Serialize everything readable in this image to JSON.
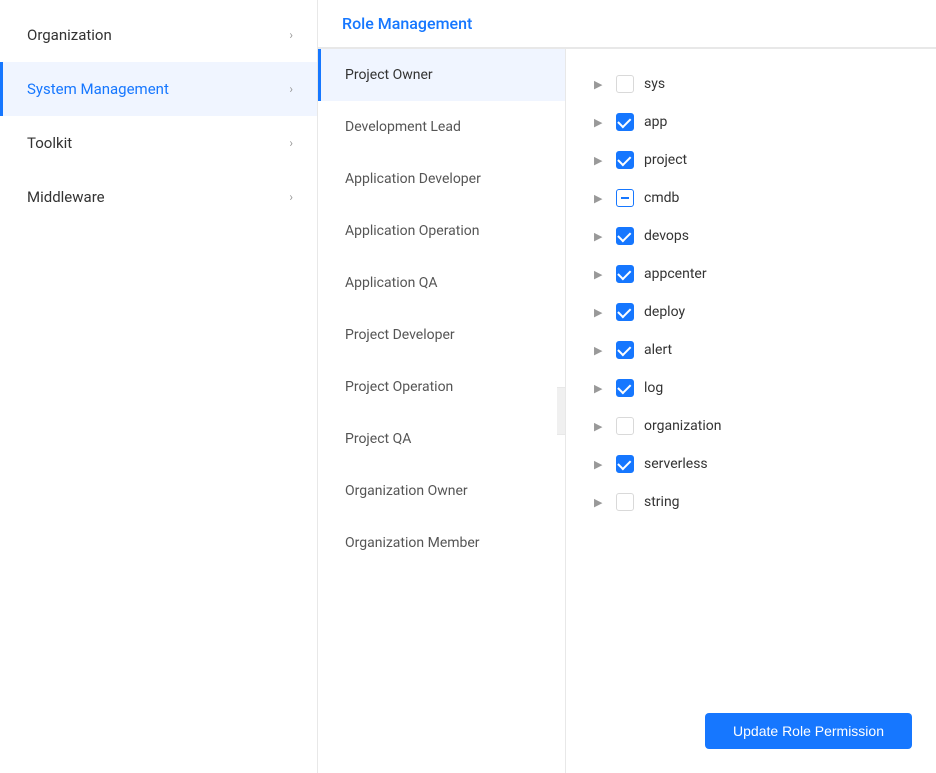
{
  "sidebar": {
    "items": [
      {
        "id": "organization",
        "label": "Organization",
        "hasArrow": true,
        "active": false
      },
      {
        "id": "system-management",
        "label": "System Management",
        "hasArrow": true,
        "active": true
      },
      {
        "id": "toolkit",
        "label": "Toolkit",
        "hasArrow": true,
        "active": false
      },
      {
        "id": "middleware",
        "label": "Middleware",
        "hasArrow": true,
        "active": false
      }
    ]
  },
  "page": {
    "title": "Role Management"
  },
  "roles": [
    {
      "id": "project-owner",
      "label": "Project Owner",
      "active": true
    },
    {
      "id": "development-lead",
      "label": "Development Lead",
      "active": false
    },
    {
      "id": "application-developer",
      "label": "Application Developer",
      "active": false
    },
    {
      "id": "application-operation",
      "label": "Application Operation",
      "active": false
    },
    {
      "id": "application-qa",
      "label": "Application QA",
      "active": false
    },
    {
      "id": "project-developer",
      "label": "Project Developer",
      "active": false
    },
    {
      "id": "project-operation",
      "label": "Project Operation",
      "active": false
    },
    {
      "id": "project-qa",
      "label": "Project QA",
      "active": false
    },
    {
      "id": "organization-owner",
      "label": "Organization Owner",
      "active": false
    },
    {
      "id": "organization-member",
      "label": "Organization Member",
      "active": false
    }
  ],
  "permissions": [
    {
      "id": "sys",
      "label": "sys",
      "state": "unchecked"
    },
    {
      "id": "app",
      "label": "app",
      "state": "checked"
    },
    {
      "id": "project",
      "label": "project",
      "state": "checked"
    },
    {
      "id": "cmdb",
      "label": "cmdb",
      "state": "indeterminate"
    },
    {
      "id": "devops",
      "label": "devops",
      "state": "checked"
    },
    {
      "id": "appcenter",
      "label": "appcenter",
      "state": "checked"
    },
    {
      "id": "deploy",
      "label": "deploy",
      "state": "checked"
    },
    {
      "id": "alert",
      "label": "alert",
      "state": "checked"
    },
    {
      "id": "log",
      "label": "log",
      "state": "checked"
    },
    {
      "id": "organization",
      "label": "organization",
      "state": "unchecked"
    },
    {
      "id": "serverless",
      "label": "serverless",
      "state": "checked"
    },
    {
      "id": "string",
      "label": "string",
      "state": "unchecked"
    }
  ],
  "buttons": {
    "update_label": "Update Role Permission"
  },
  "collapse_icon": "«"
}
